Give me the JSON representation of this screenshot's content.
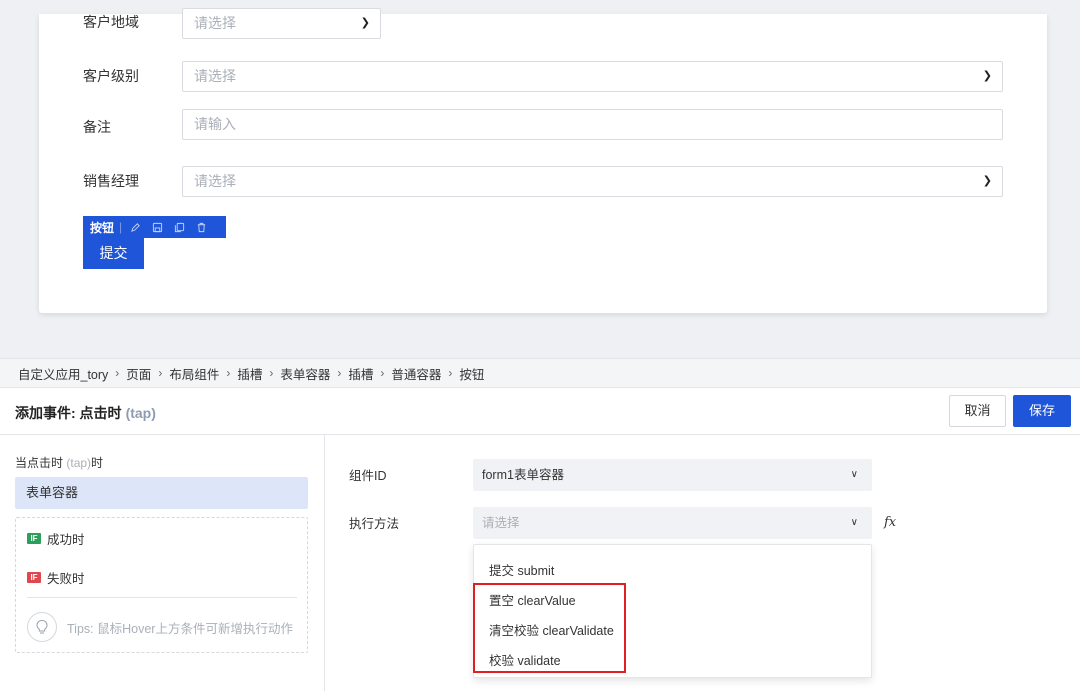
{
  "form": {
    "fields": [
      {
        "label": "客户地域",
        "placeholder": "请选择"
      },
      {
        "label": "客户级别",
        "placeholder": "请选择"
      },
      {
        "label": "备注",
        "placeholder": "请输入"
      },
      {
        "label": "销售经理",
        "placeholder": "请选择"
      }
    ],
    "toolbar_label": "按钮",
    "submit_label": "提交"
  },
  "breadcrumb": [
    "自定义应用_tory",
    "页面",
    "布局组件",
    "插槽",
    "表单容器",
    "插槽",
    "普通容器",
    "按钮"
  ],
  "panel": {
    "title": "添加事件: 点击时",
    "title_sub": "(tap)",
    "cancel_label": "取消",
    "save_label": "保存"
  },
  "left": {
    "trigger_prefix": "当点击时",
    "trigger_muted": "(tap)",
    "trigger_suffix": "时",
    "target": "表单容器",
    "success_badge": "IF",
    "success_label": "成功时",
    "fail_badge": "IF",
    "fail_label": "失败时",
    "tips": "Tips: 鼠标Hover上方条件可新增执行动作"
  },
  "right": {
    "component_id_label": "组件ID",
    "component_id_value": "form1表单容器",
    "method_label": "执行方法",
    "method_placeholder": "请选择",
    "fx_label": "fx",
    "options": [
      "提交 submit",
      "置空 clearValue",
      "清空校验 clearValidate",
      "校验 validate"
    ]
  },
  "colors": {
    "primary": "#1f56d9",
    "success": "#2aa05a",
    "danger": "#e0484f",
    "highlight": "#e02020"
  }
}
